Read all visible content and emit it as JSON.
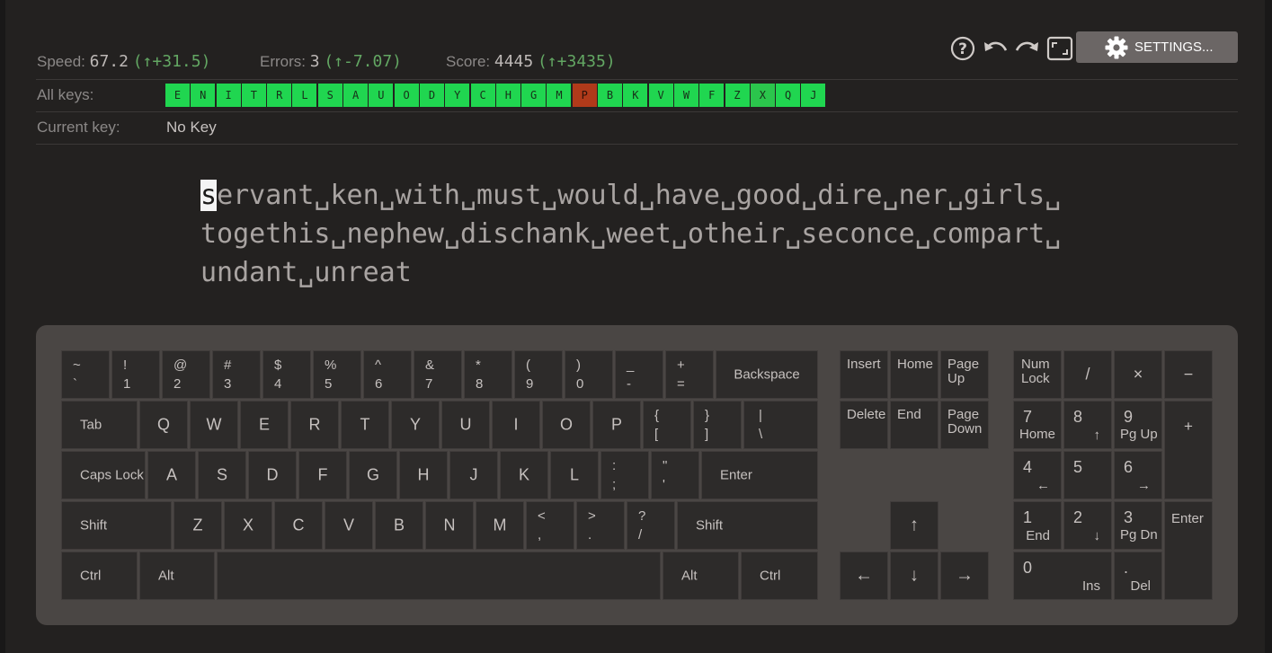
{
  "stats": {
    "speed_label": "Speed:",
    "speed_value": "67.2",
    "speed_delta": "(↑+31.5)",
    "errors_label": "Errors:",
    "errors_value": "3",
    "errors_delta": "(↑-7.07)",
    "score_label": "Score:",
    "score_value": "4445",
    "score_delta": "(↑+3435)"
  },
  "toolbar": {
    "help": "?",
    "undo": "↶",
    "redo": "↷",
    "settings_label": "SETTINGS..."
  },
  "all_keys": {
    "label": "All keys:",
    "keys": [
      "E",
      "N",
      "I",
      "T",
      "R",
      "L",
      "S",
      "A",
      "U",
      "O",
      "D",
      "Y",
      "C",
      "H",
      "G",
      "M",
      "P",
      "B",
      "K",
      "V",
      "W",
      "F",
      "Z",
      "X",
      "Q",
      "J"
    ]
  },
  "current_key": {
    "label": "Current key:",
    "value": "No Key"
  },
  "practice_text": {
    "cursor_char": "s",
    "line1": "ervant␣ken␣with␣must␣would␣have␣good␣dire␣ner␣girls␣",
    "line2": "togethis␣nephew␣dischank␣weet␣otheir␣seconce␣compart␣",
    "line3": "undant␣unreat"
  },
  "keyboard": {
    "row1": [
      [
        "~",
        "`"
      ],
      [
        "!",
        "1"
      ],
      [
        "@",
        "2"
      ],
      [
        "#",
        "3"
      ],
      [
        "$",
        "4"
      ],
      [
        "%",
        "5"
      ],
      [
        "^",
        "6"
      ],
      [
        "&",
        "7"
      ],
      [
        "*",
        "8"
      ],
      [
        "(",
        "9"
      ],
      [
        ")",
        "0"
      ],
      [
        "_",
        "-"
      ],
      [
        "+",
        "="
      ]
    ],
    "backspace": "Backspace",
    "tab": "Tab",
    "row2": [
      "Q",
      "W",
      "E",
      "R",
      "T",
      "Y",
      "U",
      "I",
      "O",
      "P"
    ],
    "row2_sym": [
      [
        "{",
        "["
      ],
      [
        "}",
        "]"
      ],
      [
        "|",
        "\\"
      ]
    ],
    "caps": "Caps Lock",
    "row3": [
      "A",
      "S",
      "D",
      "F",
      "G",
      "H",
      "J",
      "K",
      "L"
    ],
    "row3_sym": [
      [
        ":",
        ";"
      ],
      [
        "\"",
        "'"
      ]
    ],
    "enter": "Enter",
    "shift": "Shift",
    "row4": [
      "Z",
      "X",
      "C",
      "V",
      "B",
      "N",
      "M"
    ],
    "row4_sym": [
      [
        "<",
        ","
      ],
      [
        ">",
        "."
      ],
      [
        "?",
        "/"
      ]
    ],
    "ctrl": "Ctrl",
    "alt": "Alt",
    "nav": {
      "insert": "Insert",
      "home": "Home",
      "page_up": "Page Up",
      "delete": "Delete",
      "end": "End",
      "page_down": "Page Down"
    },
    "arrows": {
      "up": "↑",
      "left": "←",
      "down": "↓",
      "right": "→"
    },
    "numpad": {
      "numlock": "Num Lock",
      "divide": "/",
      "multiply": "×",
      "minus": "−",
      "plus": "+",
      "enter": "Enter",
      "n7": "7",
      "n7s": "Home",
      "n8": "8",
      "n8s": "↑",
      "n9": "9",
      "n9s": "Pg Up",
      "n4": "4",
      "n4s": "←",
      "n5": "5",
      "n6": "6",
      "n6s": "→",
      "n1": "1",
      "n1s": "End",
      "n2": "2",
      "n2s": "↓",
      "n3": "3",
      "n3s": "Pg Dn",
      "n0": "0",
      "n0s": "Ins",
      "dot": ".",
      "dots": "Del"
    }
  }
}
